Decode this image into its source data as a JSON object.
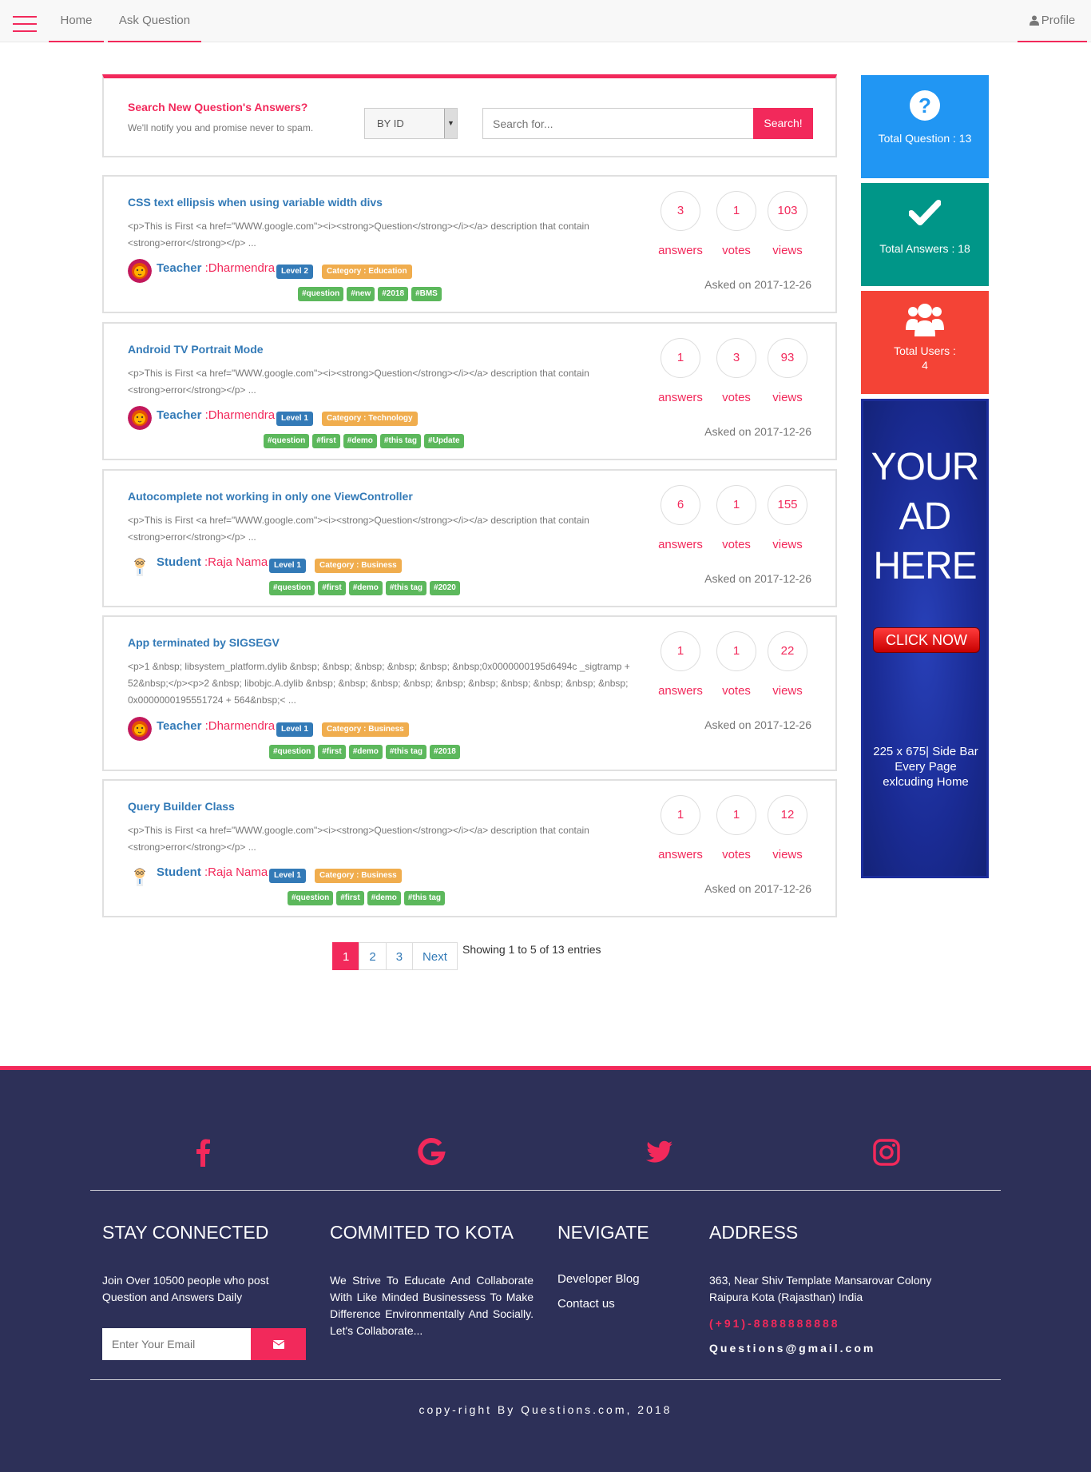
{
  "nav": {
    "home": "Home",
    "ask": "Ask Question",
    "profile": "Profile"
  },
  "search": {
    "title": "Search New Question's Answers?",
    "subtitle": "We'll notify you and promise never to spam.",
    "select_value": "BY ID",
    "placeholder": "Search for...",
    "button": "Search!"
  },
  "questions": [
    {
      "title": "CSS text ellipsis when using variable width divs",
      "desc": "<p>This is First <a href=\"WWW.google.com\"><i><strong>Question</strong></i></a> description that contain <strong>error</strong></p> ...",
      "role": "Teacher",
      "user": ":Dharmendra",
      "level": "Level 2",
      "category": "Category : Education",
      "tags": [
        "#question",
        "#new",
        "#2018",
        "#BMS"
      ],
      "answers": "3",
      "votes": "1",
      "views": "103",
      "asked": "Asked on 2017-12-26"
    },
    {
      "title": "Android TV Portrait Mode",
      "desc": "<p>This is First <a href=\"WWW.google.com\"><i><strong>Question</strong></i></a> description that contain <strong>error</strong></p> ...",
      "role": "Teacher",
      "user": ":Dharmendra",
      "level": "Level 1",
      "category": "Category : Technology",
      "tags": [
        "#question",
        "#first",
        "#demo",
        "#this tag",
        "#Update"
      ],
      "answers": "1",
      "votes": "3",
      "views": "93",
      "asked": "Asked on 2017-12-26"
    },
    {
      "title": "Autocomplete not working in only one ViewController",
      "desc": "<p>This is First <a href=\"WWW.google.com\"><i><strong>Question</strong></i></a> description that contain <strong>error</strong></p> ...",
      "role": "Student",
      "user": ":Raja Nama",
      "level": "Level 1",
      "category": "Category : Business",
      "tags": [
        "#question",
        "#first",
        "#demo",
        "#this tag",
        "#2020"
      ],
      "answers": "6",
      "votes": "1",
      "views": "155",
      "asked": "Asked on 2017-12-26"
    },
    {
      "title": "App terminated by SIGSEGV",
      "desc": "<p>1 &nbsp; libsystem_platform.dylib &nbsp; &nbsp; &nbsp; &nbsp; &nbsp; &nbsp;0x0000000195d6494c _sigtramp + 52&nbsp;</p><p>2 &nbsp; libobjc.A.dylib &nbsp; &nbsp; &nbsp; &nbsp; &nbsp; &nbsp; &nbsp; &nbsp; &nbsp; &nbsp; 0x0000000195551724 + 564&nbsp;< ...",
      "role": "Teacher",
      "user": ":Dharmendra",
      "level": "Level 1",
      "category": "Category : Business",
      "tags": [
        "#question",
        "#first",
        "#demo",
        "#this tag",
        "#2018"
      ],
      "answers": "1",
      "votes": "1",
      "views": "22",
      "asked": "Asked on 2017-12-26"
    },
    {
      "title": "Query Builder Class",
      "desc": "<p>This is First <a href=\"WWW.google.com\"><i><strong>Question</strong></i></a> description that contain <strong>error</strong></p> ...",
      "role": "Student",
      "user": ":Raja Nama",
      "level": "Level 1",
      "category": "Category : Business",
      "tags": [
        "#question",
        "#first",
        "#demo",
        "#this tag"
      ],
      "answers": "1",
      "votes": "1",
      "views": "12",
      "asked": "Asked on 2017-12-26"
    }
  ],
  "stat_labels": {
    "answers": "answers",
    "votes": "votes",
    "views": "views"
  },
  "pagination": {
    "pages": [
      "1",
      "2",
      "3"
    ],
    "next": "Next",
    "showing": "Showing 1 to 5 of 13 entries"
  },
  "sidebar": {
    "total_questions": "Total Question : 13",
    "total_answers": "Total Answers : 18",
    "total_users_label": "Total Users :",
    "total_users_value": "4",
    "ad_line1": "YOUR",
    "ad_line2": "AD",
    "ad_line3": "HERE",
    "ad_button": "CLICK NOW",
    "ad_size": "225 x 675| Side Bar Every Page exlcuding Home"
  },
  "colors": {
    "accent": "#f2295b",
    "link": "#337ab7",
    "questions_box": "#2196f3",
    "answers_box": "#009688",
    "users_box": "#f44336",
    "footer_bg": "#2d3058"
  },
  "footer": {
    "col1_title": "STAY CONNECTED",
    "col1_text": "Join Over 10500 people who post Question and Answers Daily",
    "email_placeholder": "Enter Your Email",
    "col2_title": "COMMITED TO KOTA",
    "col2_text": "We Strive To Educate And Collaborate With Like Minded Businessess To Make Difference Environmentally And Socially. Let's Collaborate...",
    "col3_title": "NEVIGATE",
    "link1": "Developer Blog",
    "link2": "Contact us",
    "col4_title": "ADDRESS",
    "address": "363, Near Shiv Template Mansarovar Colony Raipura Kota (Rajasthan) India",
    "phone": "(+91)-8888888888",
    "email": "Questions@gmail.com",
    "copyright": "copy-right By Questions.com, 2018"
  }
}
